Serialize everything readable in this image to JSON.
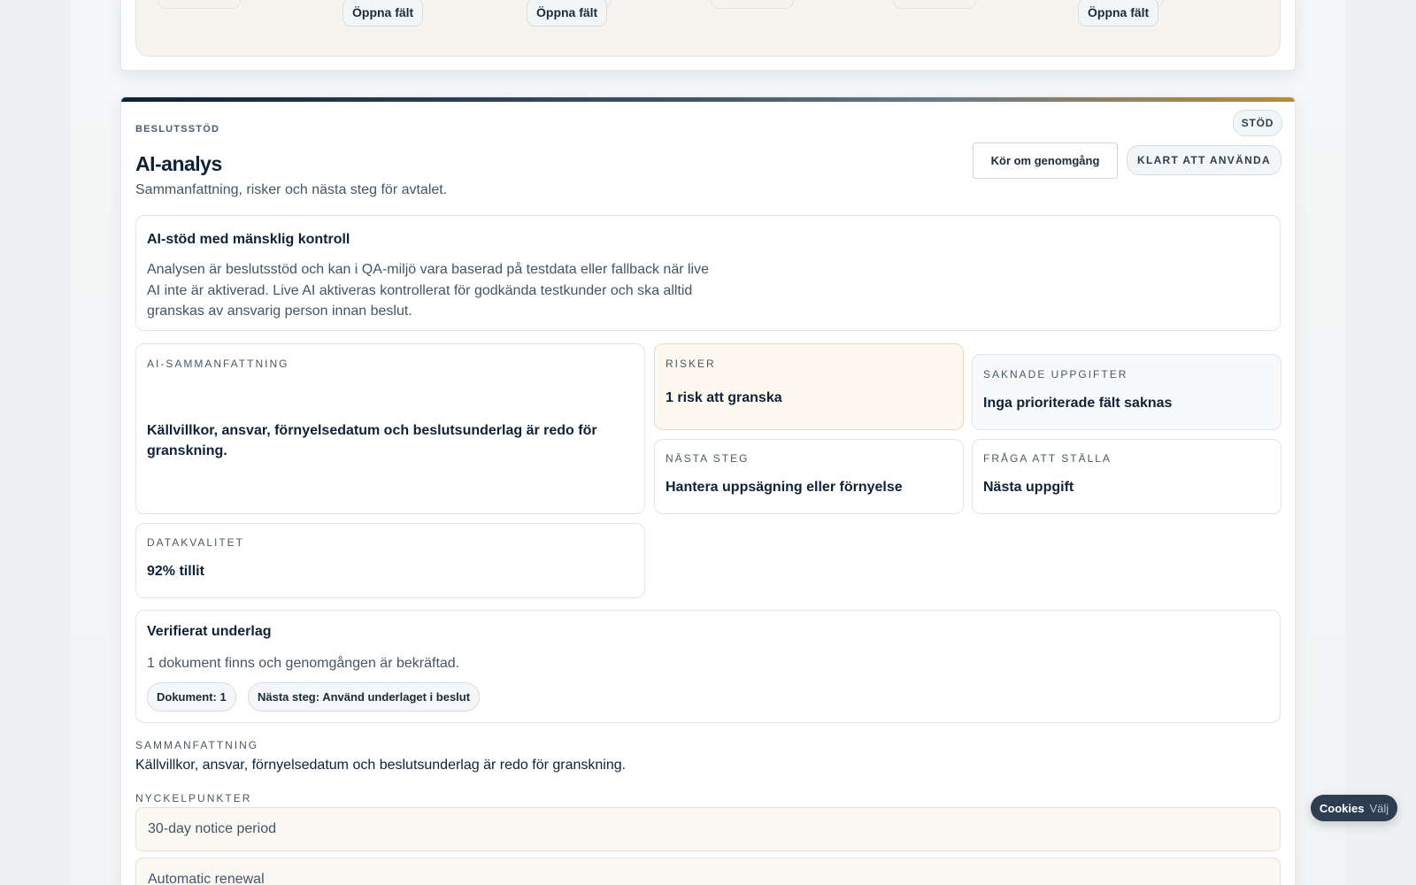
{
  "top_section": {
    "open_field_label": "Öppna fält"
  },
  "header": {
    "eyebrow": "BESLUTSSTÖD",
    "title": "AI-analys",
    "subtitle": "Sammanfattning, risker och nästa steg för avtalet.",
    "badge": "STÖD",
    "rerun_button": "Kör om genomgång",
    "status_pill": "KLART ATT ANVÄNDA"
  },
  "notice": {
    "title": "AI-stöd med mänsklig kontroll",
    "text_lines": [
      "Analysen är beslutsstöd och kan i QA-miljö vara baserad på testdata eller fallback när live",
      "AI inte är aktiverad. Live AI aktiveras kontrollerat för godkända testkunder och ska alltid",
      "granskas av ansvarig person innan beslut."
    ]
  },
  "tiles": {
    "summary": {
      "label": "AI-SAMMANFATTNING",
      "value_lines": [
        "Källvillkor, ansvar, förnyelsedatum och beslutsunderlag är redo för",
        "granskning."
      ]
    },
    "risks": {
      "label": "RISKER",
      "value": "1 risk att granska"
    },
    "missing": {
      "label": "SAKNADE UPPGIFTER",
      "value": "Inga prioriterade fält saknas"
    },
    "next_step": {
      "label": "NÄSTA STEG",
      "value": "Hantera uppsägning eller förnyelse"
    },
    "question": {
      "label": "FRÅGA ATT STÄLLA",
      "value": "Nästa uppgift"
    },
    "data_quality": {
      "label": "DATAKVALITET",
      "value": "92% tillit"
    }
  },
  "verified": {
    "title": "Verifierat underlag",
    "text": "1 dokument finns och genomgången är bekräftad.",
    "tags": [
      "Dokument: 1",
      "Nästa steg: Använd underlaget i beslut"
    ]
  },
  "summary_section": {
    "label": "SAMMANFATTNING",
    "text": "Källvillkor, ansvar, förnyelsedatum och beslutsunderlag är redo för granskning."
  },
  "key_points": {
    "label": "NYCKELPUNKTER",
    "items": [
      "30-day notice period",
      "Automatic renewal"
    ]
  },
  "cookie": {
    "main": "Cookies",
    "sub": "Välj"
  },
  "colors": {
    "accent_dark": "#0e2237",
    "accent_gold": "#b88a3e",
    "risk_bg": "#fdf9f1",
    "risk_border": "#ecd9b6"
  }
}
